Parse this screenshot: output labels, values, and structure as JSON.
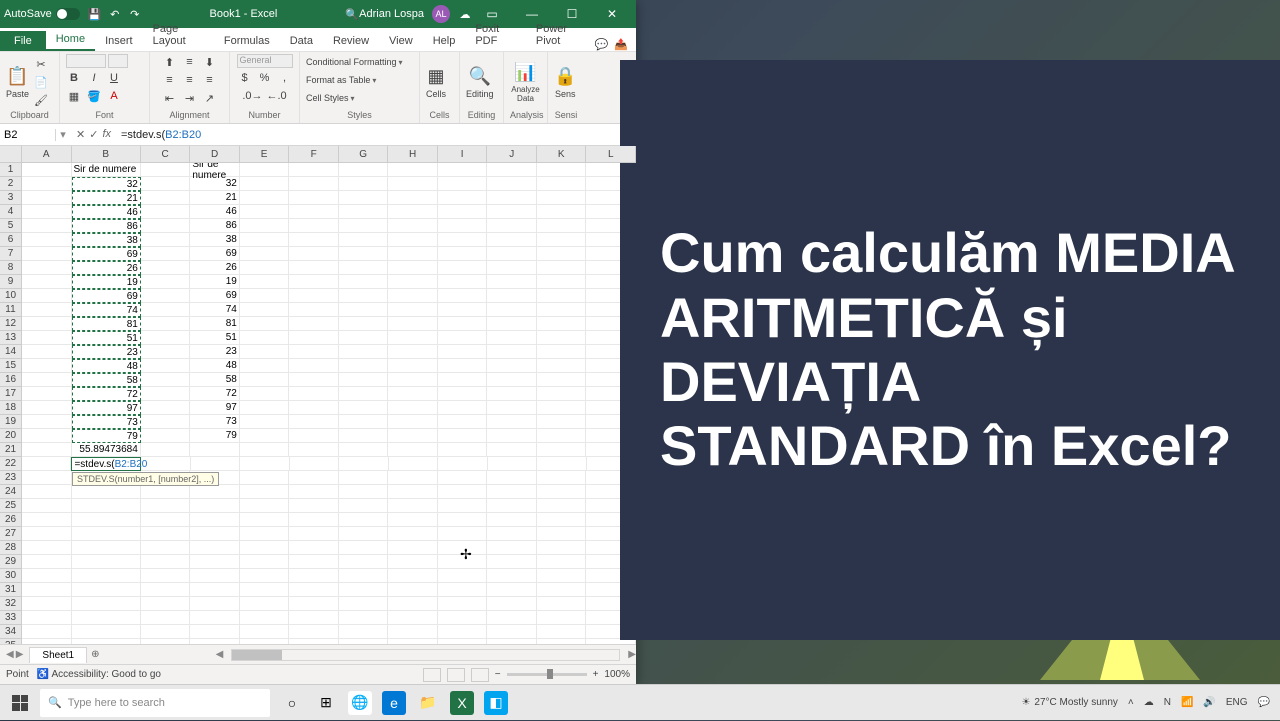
{
  "titlebar": {
    "autosave_label": "AutoSave",
    "doc_title": "Book1 - Excel",
    "user_name": "Adrian Lospa",
    "user_initials": "AL"
  },
  "tabs": {
    "file": "File",
    "list": [
      "Home",
      "Insert",
      "Page Layout",
      "Formulas",
      "Data",
      "Review",
      "View",
      "Help",
      "Foxit PDF",
      "Power Pivot"
    ],
    "active": "Home"
  },
  "ribbon": {
    "clipboard": {
      "label": "Clipboard",
      "paste": "Paste"
    },
    "font": {
      "label": "Font",
      "face": "",
      "size": ""
    },
    "alignment": {
      "label": "Alignment"
    },
    "number": {
      "label": "Number",
      "format": "General"
    },
    "styles": {
      "label": "Styles",
      "cond": "Conditional Formatting",
      "table": "Format as Table",
      "cell": "Cell Styles"
    },
    "cells": {
      "label": "Cells",
      "btn": "Cells"
    },
    "editing": {
      "label": "Editing",
      "btn": "Editing"
    },
    "analysis": {
      "label": "Analysis",
      "btn": "Analyze Data"
    },
    "sens": {
      "label": "Sensi",
      "btn": "Sens"
    }
  },
  "formula": {
    "namebox": "B2",
    "text_prefix": "=stdev.s(",
    "text_ref": "B2:B20"
  },
  "sheet": {
    "columns": [
      "A",
      "B",
      "C",
      "D",
      "E",
      "F",
      "G",
      "H",
      "I",
      "J",
      "K",
      "L"
    ],
    "row_count": 38,
    "header_b": "Sir de numere",
    "header_d": "Sir de numere",
    "values": [
      32,
      21,
      46,
      86,
      38,
      69,
      26,
      19,
      69,
      74,
      81,
      51,
      23,
      48,
      58,
      72,
      97,
      73,
      79
    ],
    "avg_value": "55.89473684",
    "editing_prefix": "=stdev.s(",
    "editing_ref": "B2:B20",
    "tooltip": "STDEV.S(number1, [number2], ...)",
    "tab_name": "Sheet1"
  },
  "statusbar": {
    "mode": "Point",
    "accessibility": "Accessibility: Good to go",
    "zoom": "100%"
  },
  "overlay": {
    "headline": "Cum calculăm MEDIA ARITMETICĂ și DEVIAȚIA STANDARD în Excel?"
  },
  "taskbar": {
    "search_placeholder": "Type here to search",
    "weather": "27°C Mostly sunny",
    "lang": "ENG",
    "time": "",
    "date": ""
  },
  "chart_data": {
    "type": "table",
    "title": "Sir de numere",
    "series": [
      {
        "name": "Sir de numere (B)",
        "values": [
          32,
          21,
          46,
          86,
          38,
          69,
          26,
          19,
          69,
          74,
          81,
          51,
          23,
          48,
          58,
          72,
          97,
          73,
          79
        ]
      },
      {
        "name": "Sir de numere (D)",
        "values": [
          32,
          21,
          46,
          86,
          38,
          69,
          26,
          19,
          69,
          74,
          81,
          51,
          23,
          48,
          58,
          72,
          97,
          73,
          79
        ]
      }
    ],
    "aggregates": {
      "mean_B": 55.89473684
    },
    "active_formula": "=stdev.s(B2:B20"
  }
}
